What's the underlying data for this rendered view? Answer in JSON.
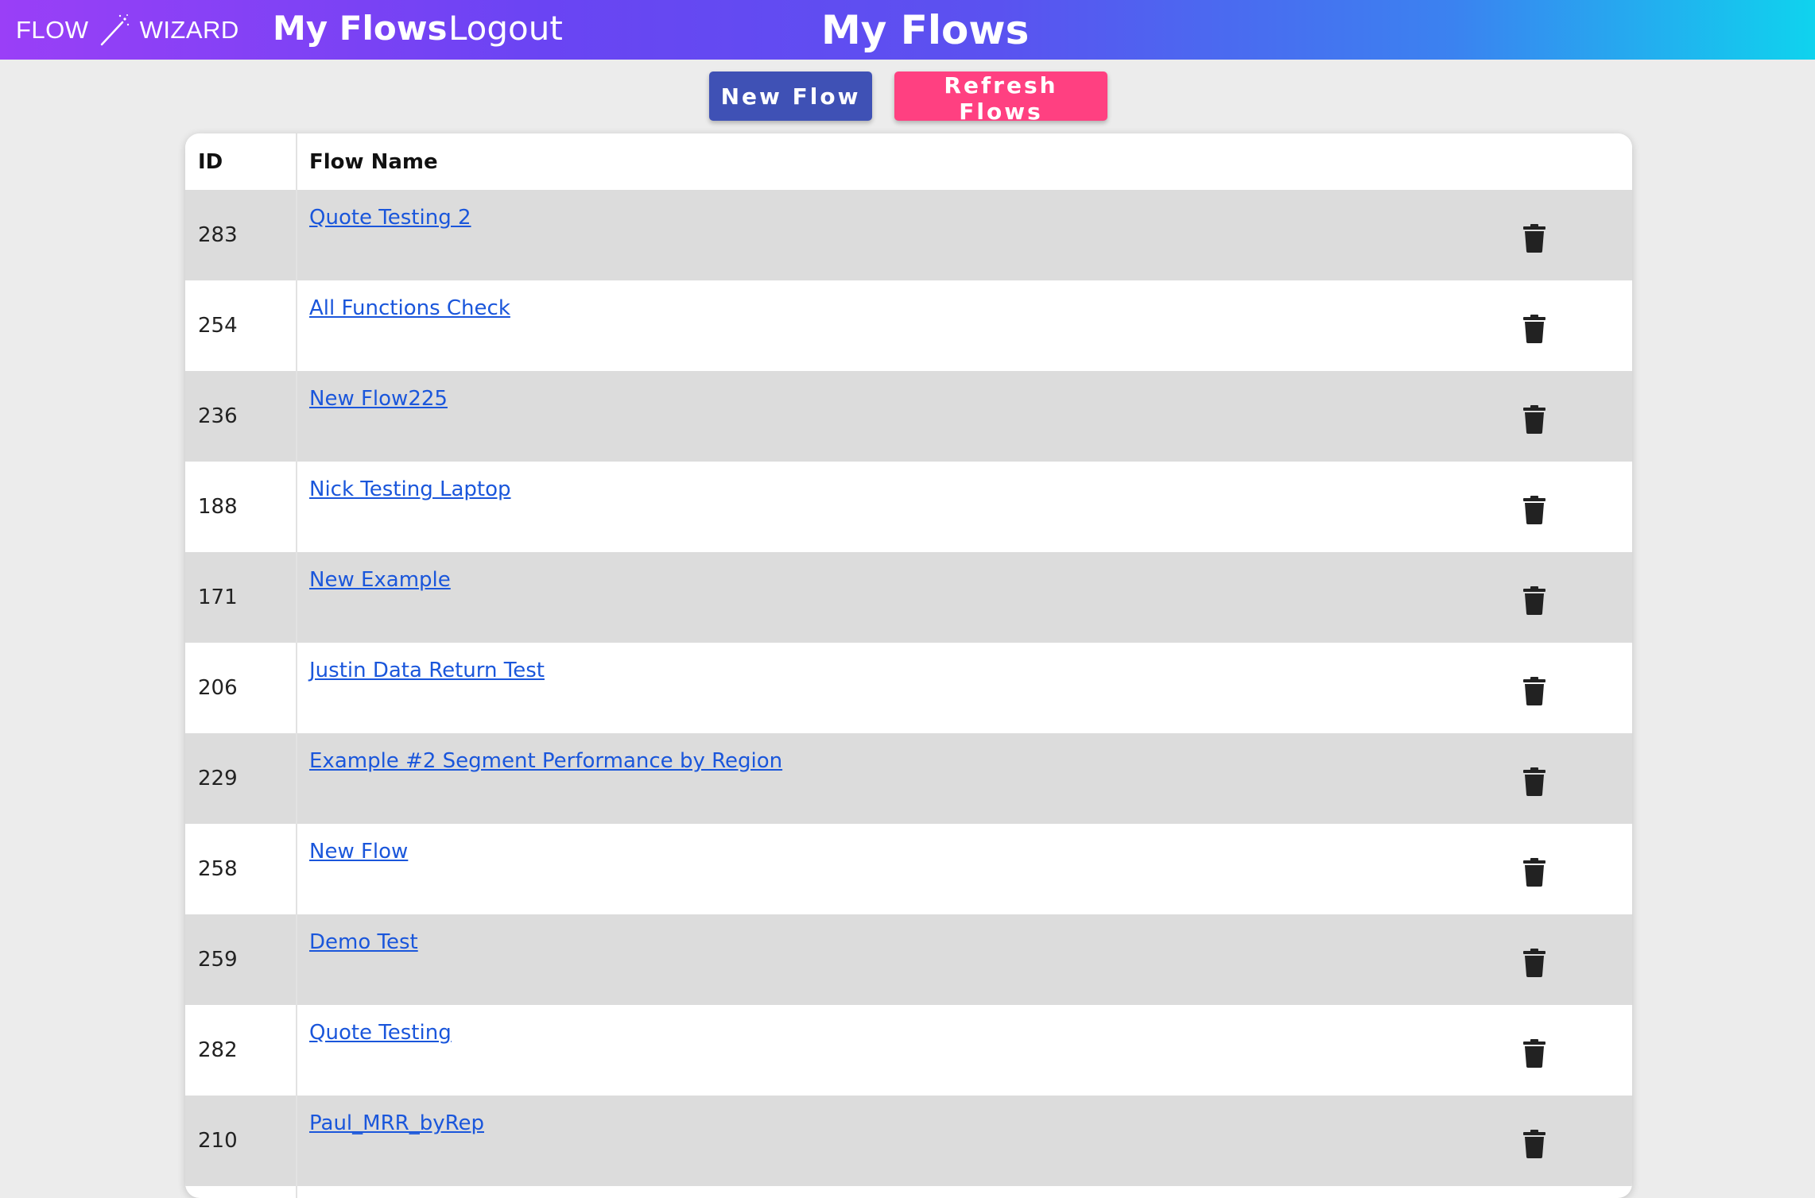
{
  "brand": {
    "left": "FLOW",
    "right": "WIZARD",
    "icon": "magic-wand-icon"
  },
  "nav": {
    "my_flows": "My Flows",
    "logout": "Logout"
  },
  "page_title": "My Flows",
  "toolbar": {
    "new_flow": "New Flow",
    "refresh_flows": "Refresh Flows"
  },
  "colors": {
    "new_button": "#3f51b5",
    "refresh_button": "#ff4081",
    "link": "#1a56db",
    "row_alt": "#dcdcdc"
  },
  "table": {
    "headers": {
      "id": "ID",
      "name": "Flow Name"
    },
    "rows": [
      {
        "id": "283",
        "name": "Quote Testing 2"
      },
      {
        "id": "254",
        "name": "All Functions Check"
      },
      {
        "id": "236",
        "name": "New Flow225"
      },
      {
        "id": "188",
        "name": "Nick Testing Laptop"
      },
      {
        "id": "171",
        "name": "New Example"
      },
      {
        "id": "206",
        "name": "Justin Data Return Test"
      },
      {
        "id": "229",
        "name": "Example #2 Segment Performance by Region"
      },
      {
        "id": "258",
        "name": "New Flow"
      },
      {
        "id": "259",
        "name": "Demo Test"
      },
      {
        "id": "282",
        "name": "Quote Testing"
      },
      {
        "id": "210",
        "name": "Paul_MRR_byRep"
      }
    ],
    "row_action_icon": "trash-icon"
  }
}
